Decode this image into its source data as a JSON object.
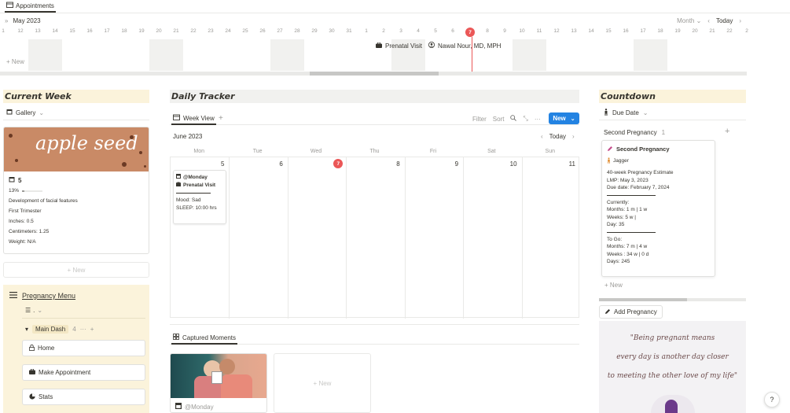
{
  "top_tab": {
    "label": "Appointments"
  },
  "timeline": {
    "month": "May 2023",
    "scale": "Month",
    "today_label": "Today",
    "days": [
      "1",
      "12",
      "13",
      "14",
      "15",
      "16",
      "17",
      "18",
      "19",
      "20",
      "21",
      "22",
      "23",
      "24",
      "25",
      "26",
      "27",
      "28",
      "29",
      "30",
      "31",
      "1",
      "2",
      "3",
      "4",
      "5",
      "6",
      "7",
      "8",
      "9",
      "10",
      "11",
      "12",
      "13",
      "14",
      "15",
      "16",
      "17",
      "18",
      "19",
      "20",
      "21",
      "22",
      "2"
    ],
    "today_day": "7",
    "new_label": "+ New",
    "event_title": "Prenatal Visit",
    "event_person": "Nawal Nour, MD, MPH"
  },
  "current_week": {
    "heading": "Current Week",
    "view_label": "Gallery",
    "image_text": "apple seed",
    "week": "5",
    "progress_text": "13%",
    "progress_value": 0.13,
    "lines": [
      "Development of facial features",
      "First Trimester",
      "Inches: 0.5",
      "Centimeters: 1.25",
      "Weight: N/A"
    ],
    "new_label": "New"
  },
  "pregnancy_menu": {
    "title": "Pregnancy Menu",
    "list_label": ".",
    "group_name": "Main Dash",
    "group_count": "4",
    "buttons": [
      "Home",
      "Make Appointment",
      "Stats"
    ]
  },
  "daily_tracker": {
    "heading": "Daily Tracker",
    "tab_label": "Week View",
    "filter": "Filter",
    "sort": "Sort",
    "new_button": "New",
    "month": "June 2023",
    "today_label": "Today",
    "weekdays": [
      "Mon",
      "Tue",
      "Wed",
      "Thu",
      "Fri",
      "Sat",
      "Sun"
    ],
    "dates": [
      "5",
      "6",
      "7",
      "8",
      "9",
      "10",
      "11"
    ],
    "today_date": "7",
    "event": {
      "title": "@Monday",
      "tag": "Prenatal Visit",
      "mood": "Mood: Sad",
      "sleep": "SLEEP: 10:00 hrs"
    }
  },
  "captured_moments": {
    "tab_label": "Captured Moments",
    "card_label": "@Monday",
    "new_label": "+ New"
  },
  "countdown": {
    "heading": "Countdown",
    "view_label": "Due Date",
    "group_name": "Second Pregnancy",
    "group_count": "1",
    "card": {
      "title": "Second Pregnancy",
      "person": "Jagger",
      "estimate": "40-week Pregnancy Estimate",
      "lmp": "LMP: May 3, 2023",
      "due": "Due date: February 7, 2024",
      "currently": "Currently:",
      "months": "Months: 1 m | 1 w",
      "weeks": "Weeks: 5 w |",
      "days": "Day: 35",
      "to_go": "To Go:",
      "to_months": "Months: 7 m | 4 w",
      "to_weeks": "Weeks : 34 w | 0 d",
      "to_days": "Days: 245"
    },
    "new_label": "+ New",
    "add_button": "Add Pregnancy",
    "quote_lines": [
      "\"Being pregnant means",
      "every day is another day closer",
      "to meeting the other love of my life\""
    ]
  },
  "help": {
    "label": "?"
  },
  "colors": {
    "accent": "#2383e2",
    "today": "#eb5757",
    "header_bg": "#fbf3db"
  }
}
